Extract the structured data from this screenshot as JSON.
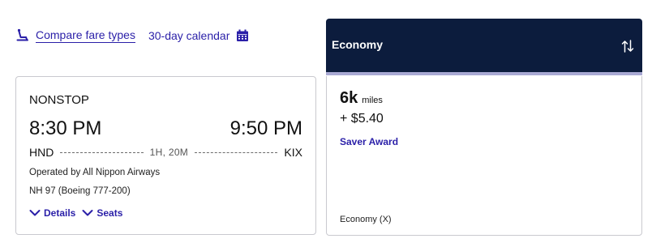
{
  "toolbar": {
    "compare_label": "Compare fare types",
    "compare_icon": "seat-icon",
    "calendar_label": "30-day calendar",
    "calendar_icon": "calendar-icon",
    "link_color": "#2a1fa8"
  },
  "flight": {
    "stops": "NONSTOP",
    "departure_time": "8:30 PM",
    "arrival_time": "9:50 PM",
    "origin": "HND",
    "destination": "KIX",
    "duration": "1H, 20M",
    "operated_by": "Operated by All Nippon Airways",
    "flight_number": "NH 97 (Boeing 777-200)",
    "details_label": "Details",
    "seats_label": "Seats"
  },
  "fare": {
    "header_title": "Economy",
    "header_color": "#0c1c3d",
    "sort_icon": "sort-arrows-icon",
    "miles_value": "6k",
    "miles_unit": "miles",
    "fee": "+ $5.40",
    "award_type": "Saver Award",
    "cabin": "Economy (X)"
  }
}
